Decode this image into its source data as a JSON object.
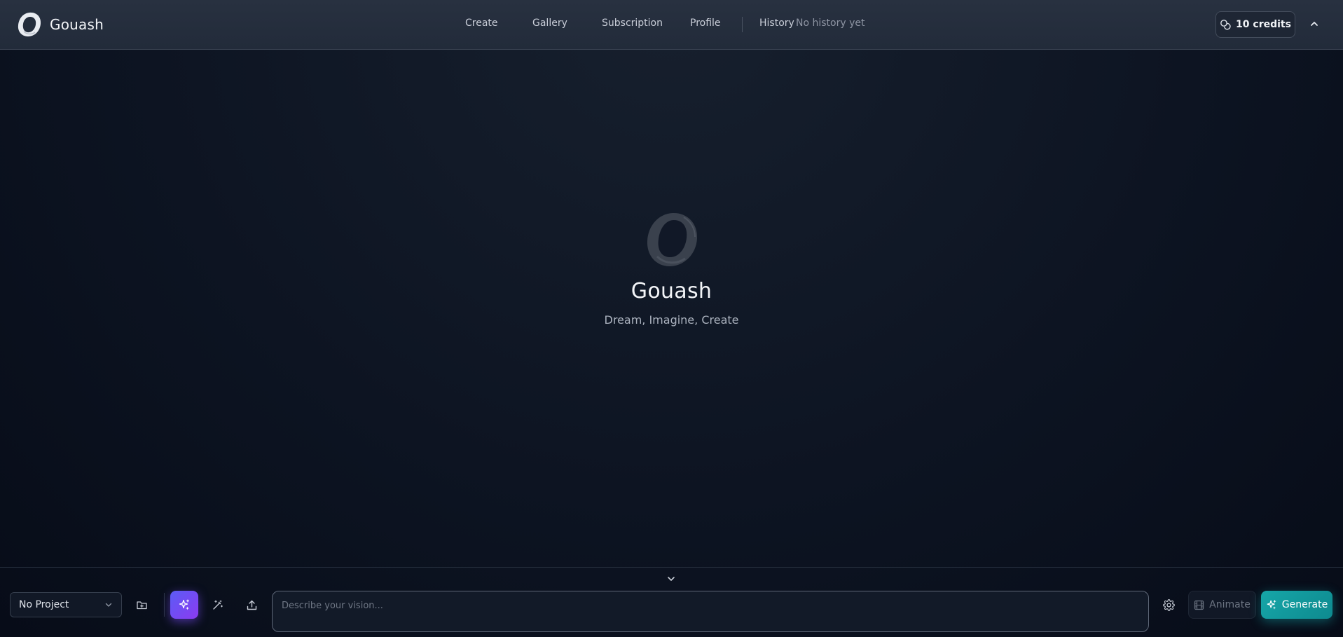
{
  "app": {
    "name": "Gouash",
    "tagline": "Dream, Imagine, Create"
  },
  "nav": {
    "items": [
      {
        "label": "Create"
      },
      {
        "label": "Gallery"
      },
      {
        "label": "Subscription"
      },
      {
        "label": "Profile"
      }
    ],
    "history_label": "History",
    "history_empty": "No history yet"
  },
  "credits": {
    "label": "10 credits"
  },
  "toolbar": {
    "project_value": "No Project",
    "prompt_placeholder": "Describe your vision...",
    "animate_label": "Animate",
    "generate_label": "Generate"
  },
  "icons": {
    "logo": "ring-logo-icon",
    "credits": "coins-icon",
    "collapse": "chevron-up-icon",
    "expand": "chevron-down-icon",
    "project_dropdown": "chevron-down-icon",
    "new_project": "folder-plus-icon",
    "enhance": "sparkles-icon",
    "magic": "magic-wand-icon",
    "upload": "upload-icon",
    "settings": "gear-icon",
    "animate": "film-icon",
    "generate": "sparkles-icon"
  },
  "colors": {
    "accent_generate": "#14a3a6",
    "accent_enhance": "#6d4cf5",
    "header_bg": "#262f3e",
    "page_bg": "#0d1422"
  }
}
